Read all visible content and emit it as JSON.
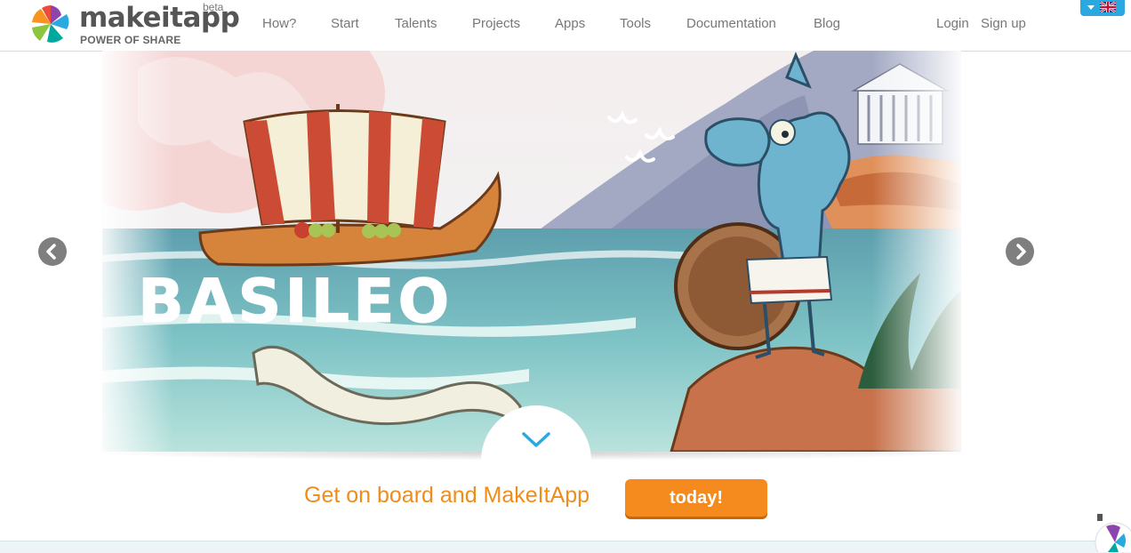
{
  "brand": {
    "name": "makeitapp",
    "badge": "beta",
    "tagline": "POWER OF SHARE"
  },
  "nav": {
    "items": [
      {
        "label": "How?"
      },
      {
        "label": "Start"
      },
      {
        "label": "Talents"
      },
      {
        "label": "Projects"
      },
      {
        "label": "Apps"
      },
      {
        "label": "Tools"
      },
      {
        "label": "Documentation"
      },
      {
        "label": "Blog"
      }
    ],
    "login": "Login",
    "signup": "Sign up",
    "language_icon": "uk-flag-icon"
  },
  "hero": {
    "title": "BASILEO"
  },
  "cta": {
    "text": "Get on board and MakeItApp",
    "button": "today!"
  },
  "colors": {
    "accent_orange": "#f58b1f",
    "cta_text": "#f08c1a",
    "lang_blue": "#2aa9e0"
  }
}
